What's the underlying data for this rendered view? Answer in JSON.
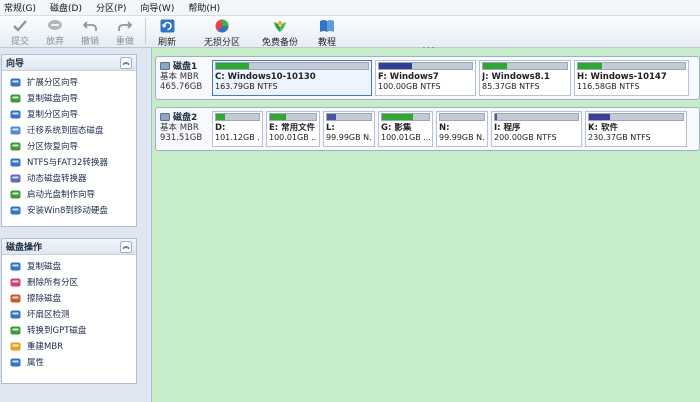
{
  "menu": [
    "常规(G)",
    "磁盘(D)",
    "分区(P)",
    "向导(W)",
    "帮助(H)"
  ],
  "toolbar": {
    "commit": "提交",
    "discard": "放弃",
    "undo": "撤销",
    "redo": "重做",
    "refresh": "刷新",
    "lossless": "无损分区",
    "backup": "免费备份",
    "tutorial": "教程"
  },
  "wizard_panel": {
    "title": "向导",
    "items": [
      {
        "label": "扩展分区向导",
        "icon": "extend-partition-icon"
      },
      {
        "label": "复制磁盘向导",
        "icon": "copy-disk-icon"
      },
      {
        "label": "复制分区向导",
        "icon": "copy-partition-icon"
      },
      {
        "label": "迁移系统到固态磁盘",
        "icon": "migrate-os-icon"
      },
      {
        "label": "分区恢复向导",
        "icon": "partition-recovery-icon"
      },
      {
        "label": "NTFS与FAT32转换器",
        "icon": "ntfs-fat32-convert-icon"
      },
      {
        "label": "动态磁盘转换器",
        "icon": "dynamic-disk-convert-icon"
      },
      {
        "label": "启动光盘制作向导",
        "icon": "bootable-media-icon"
      },
      {
        "label": "安装Win8到移动硬盘",
        "icon": "win8-to-go-icon"
      }
    ]
  },
  "disk_ops_panel": {
    "title": "磁盘操作",
    "items": [
      {
        "label": "复制磁盘",
        "icon": "copy-disk-op-icon"
      },
      {
        "label": "删除所有分区",
        "icon": "delete-all-partitions-icon"
      },
      {
        "label": "擦除磁盘",
        "icon": "wipe-disk-icon"
      },
      {
        "label": "坏扇区检测",
        "icon": "bad-sector-check-icon"
      },
      {
        "label": "转换到GPT磁盘",
        "icon": "convert-gpt-icon"
      },
      {
        "label": "重建MBR",
        "icon": "rebuild-mbr-icon"
      },
      {
        "label": "属性",
        "icon": "properties-icon"
      }
    ]
  },
  "disks": [
    {
      "name": "磁盘1",
      "type": "基本 MBR",
      "size": "465.76GB",
      "partitions": [
        {
          "name": "C: Windows10-10130",
          "info": "163.79GB NTFS",
          "used": 0.22,
          "color": "#2ea82e"
        },
        {
          "name": "F: Windows7",
          "info": "100.00GB NTFS",
          "used": 0.35,
          "color": "#2f3f99"
        },
        {
          "name": "J: Windows8.1",
          "info": "85.37GB NTFS",
          "used": 0.28,
          "color": "#2ea82e"
        },
        {
          "name": "H: Windows-10147",
          "info": "116.58GB NTFS",
          "used": 0.22,
          "color": "#2ea82e"
        }
      ]
    },
    {
      "name": "磁盘2",
      "type": "基本 MBR",
      "size": "931.51GB",
      "partitions": [
        {
          "name": "D:",
          "info": "101.12GB ...",
          "used": 0.2,
          "color": "#2ea82e"
        },
        {
          "name": "E: 常用文件",
          "info": "100.01GB ...",
          "used": 0.35,
          "color": "#2ea82e"
        },
        {
          "name": "L:",
          "info": "99.99GB N...",
          "used": 0.2,
          "color": "#4a55a8"
        },
        {
          "name": "G: 影集",
          "info": "100.01GB ...",
          "used": 0.65,
          "color": "#2ea82e"
        },
        {
          "name": "N:",
          "info": "99.99GB N...",
          "used": 0.0,
          "color": "#4a55a8"
        },
        {
          "name": "I: 程序",
          "info": "200.00GB NTFS",
          "used": 0.02,
          "color": "#4a55a8"
        },
        {
          "name": "K: 软件",
          "info": "230.37GB NTFS",
          "used": 0.22,
          "color": "#3b3f9a"
        }
      ]
    }
  ]
}
